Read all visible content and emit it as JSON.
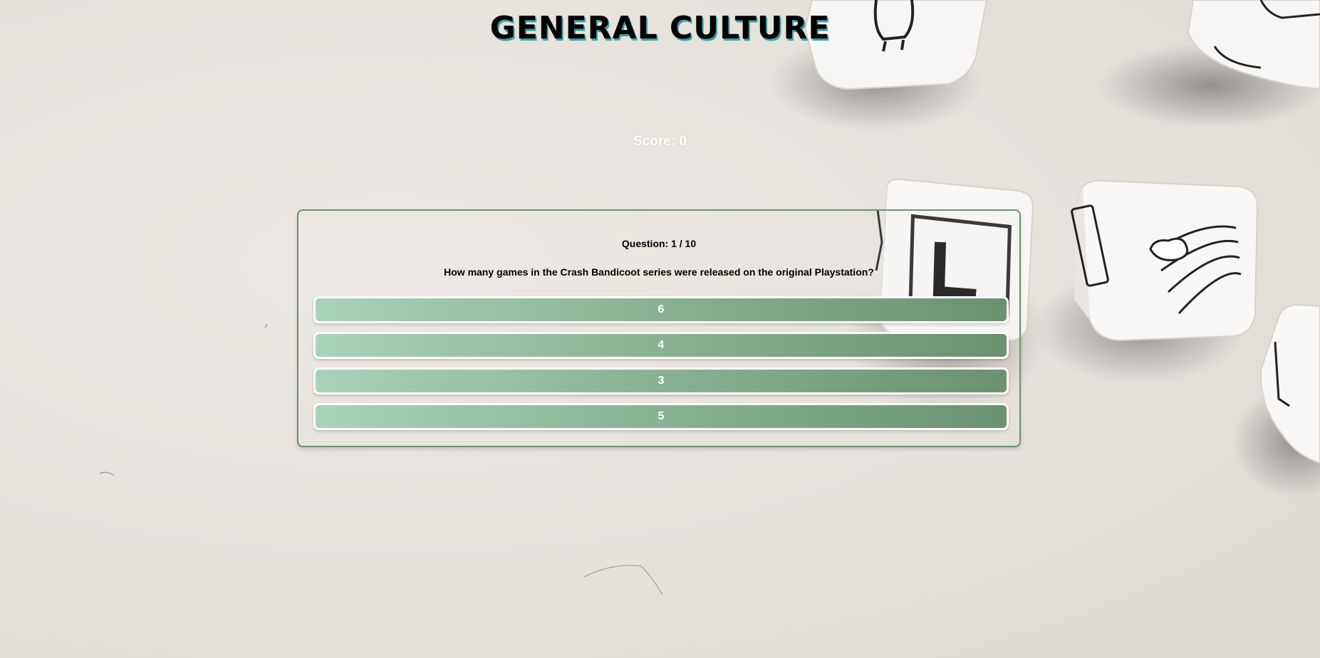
{
  "header": {
    "title": "GENERAL CULTURE"
  },
  "score": {
    "label": "Score: 0"
  },
  "quiz": {
    "progress": "Question: 1 / 10",
    "question": "How many games in the Crash Bandicoot series were released on the original Playstation?",
    "answers": [
      {
        "label": "6"
      },
      {
        "label": "4"
      },
      {
        "label": "3"
      },
      {
        "label": "5"
      }
    ]
  },
  "colors": {
    "title_shadow": "#3c9fa8",
    "card_border": "#6a9270",
    "button_gradient_start": "#a8d3b8",
    "button_gradient_end": "#6a9270",
    "button_border": "#ffffff"
  }
}
